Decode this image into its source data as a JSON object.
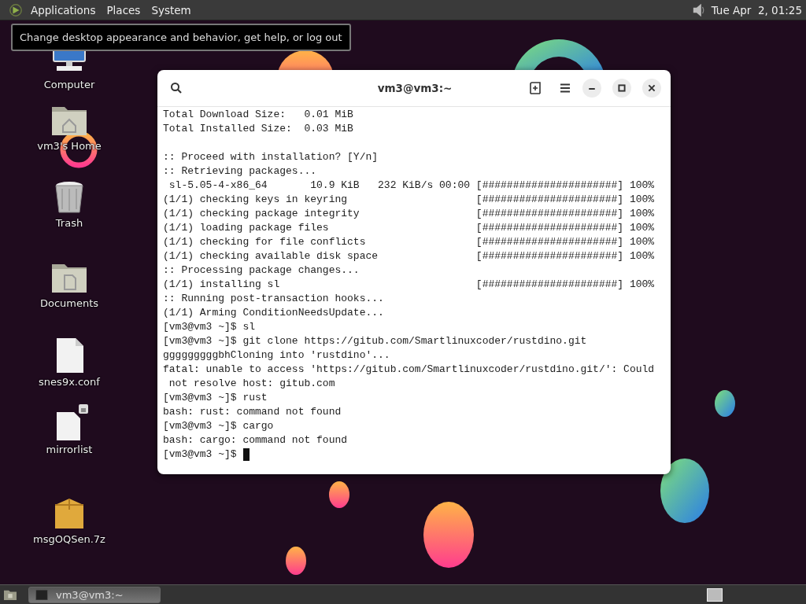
{
  "top_panel": {
    "menus": [
      "Applications",
      "Places",
      "System"
    ],
    "clock": "Tue Apr  2, 01:25"
  },
  "tooltip": "Change desktop appearance and behavior, get help, or log out",
  "desktop_icons": [
    {
      "label": "Computer",
      "kind": "computer"
    },
    {
      "label": "vm3's Home",
      "kind": "home"
    },
    {
      "label": "Trash",
      "kind": "trash"
    },
    {
      "label": "Documents",
      "kind": "documents"
    },
    {
      "label": "snes9x.conf",
      "kind": "file"
    },
    {
      "label": "mirrorlist",
      "kind": "locked-file"
    },
    {
      "label": "msgOQSen.7z",
      "kind": "archive"
    }
  ],
  "terminal": {
    "title": "vm3@vm3:~",
    "lines": [
      "Total Download Size:   0.01 MiB",
      "Total Installed Size:  0.03 MiB",
      {
        "kind": "blank"
      },
      ":: Proceed with installation? [Y/n]",
      ":: Retrieving packages...",
      " sl-5.05-4-x86_64       10.9 KiB   232 KiB/s 00:00 [######################] 100%",
      "(1/1) checking keys in keyring                     [######################] 100%",
      "(1/1) checking package integrity                   [######################] 100%",
      "(1/1) loading package files                        [######################] 100%",
      "(1/1) checking for file conflicts                  [######################] 100%",
      "(1/1) checking available disk space                [######################] 100%",
      ":: Processing package changes...",
      "(1/1) installing sl                                [######################] 100%",
      ":: Running post-transaction hooks...",
      "(1/1) Arming ConditionNeedsUpdate...",
      "[vm3@vm3 ~]$ sl",
      "[vm3@vm3 ~]$ git clone https://gitub.com/Smartlinuxcoder/rustdino.git",
      "gggggggggbhCloning into 'rustdino'...",
      "fatal: unable to access 'https://gitub.com/Smartlinuxcoder/rustdino.git/': Could",
      " not resolve host: gitub.com",
      "[vm3@vm3 ~]$ rust",
      "bash: rust: command not found",
      "[vm3@vm3 ~]$ cargo",
      "bash: cargo: command not found",
      "[vm3@vm3 ~]$"
    ]
  },
  "taskbar": {
    "tasks": [
      {
        "label": "vm3@vm3:~",
        "selected": true
      }
    ]
  }
}
